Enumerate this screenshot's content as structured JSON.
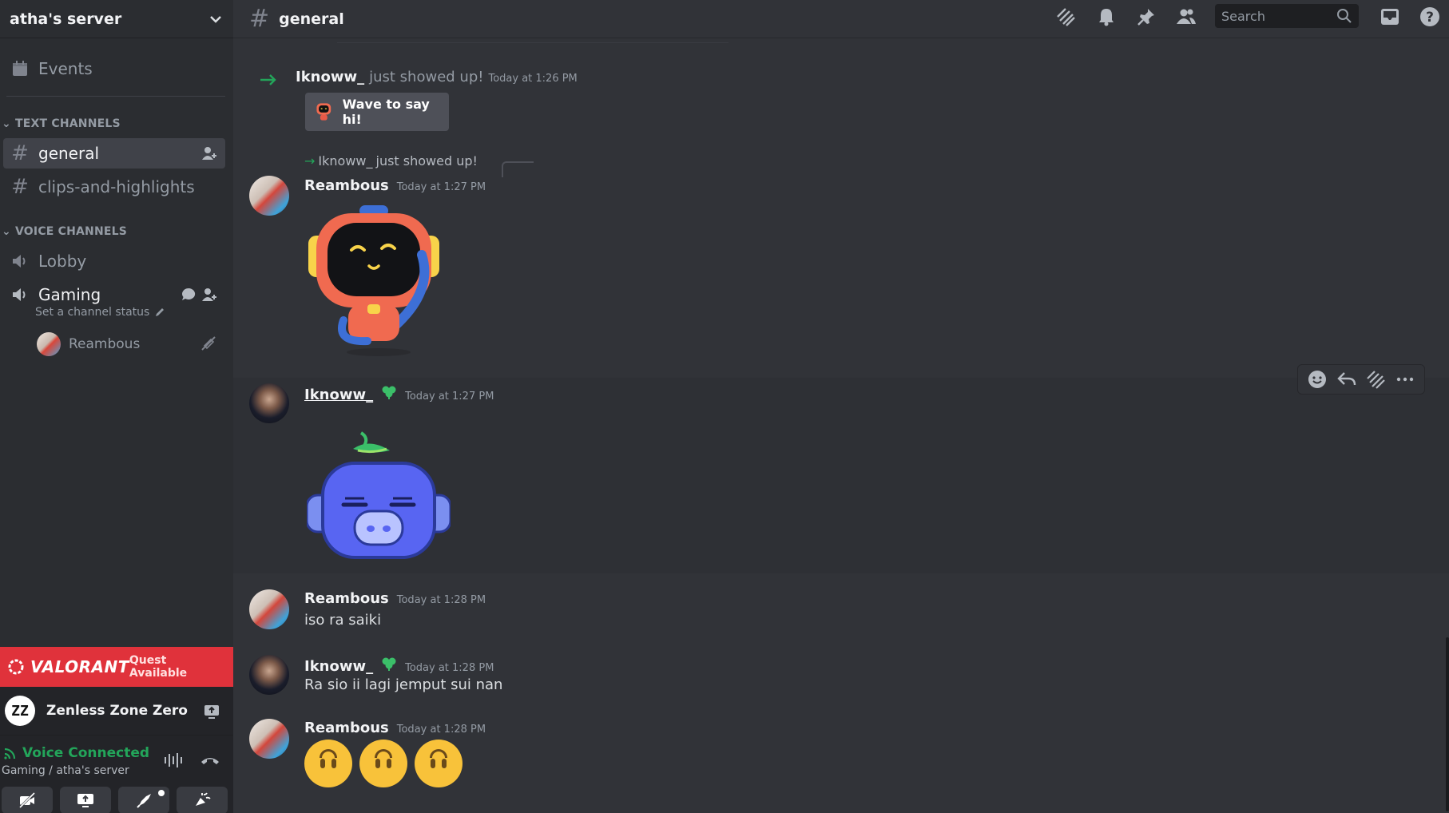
{
  "server": {
    "name": "atha's server"
  },
  "sidebar": {
    "events_label": "Events",
    "text_category": "TEXT CHANNELS",
    "text_channels": [
      {
        "name": "general",
        "active": true
      },
      {
        "name": "clips-and-highlights",
        "active": false
      }
    ],
    "voice_category": "VOICE CHANNELS",
    "voice_channels": [
      {
        "name": "Lobby"
      },
      {
        "name": "Gaming",
        "status_placeholder": "Set a channel status",
        "members": [
          "Reambous"
        ]
      }
    ]
  },
  "quest": {
    "game": "VALORANT",
    "label": "Quest Available"
  },
  "activity": {
    "game": "Zenless Zone Zero",
    "logo": "ZZ"
  },
  "voice_panel": {
    "title": "Voice Connected",
    "subtitle": "Gaming / atha's server"
  },
  "header": {
    "channel": "general",
    "search_placeholder": "Search"
  },
  "messages": {
    "join": {
      "user": "Iknoww_",
      "text": "just showed up!",
      "time": "Today at 1:26 PM",
      "button": "Wave to say hi!"
    },
    "reply_preview": {
      "user": "Iknoww_",
      "text": "just showed up!"
    },
    "m1": {
      "user": "Reambous",
      "time": "Today at 1:27 PM",
      "content": "robot waving sticker"
    },
    "m2": {
      "user": "Iknoww_",
      "time": "Today at 1:27 PM",
      "content": "blue sleepy robot sticker"
    },
    "m3": {
      "user": "Reambous",
      "time": "Today at 1:28 PM",
      "text": "iso ra saiki"
    },
    "m4": {
      "user": "Iknoww_",
      "time": "Today at 1:28 PM",
      "text": "Ra sio ii lagi jemput sui nan"
    },
    "m5": {
      "user": "Reambous",
      "time": "Today at 1:28 PM",
      "emoji_count": 3
    }
  },
  "colors": {
    "accent_green": "#23a55a",
    "quest_red": "#e0323b",
    "bg": "#313338",
    "sidebar": "#2b2d31"
  }
}
